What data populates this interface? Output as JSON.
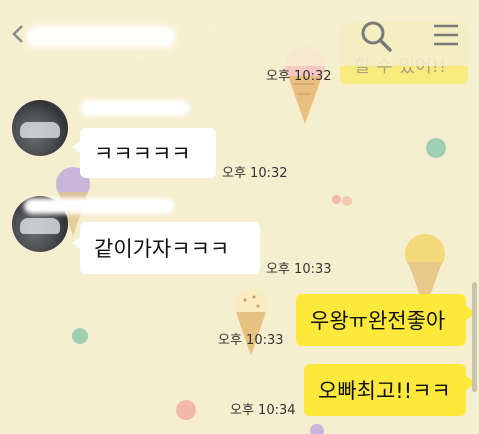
{
  "header": {
    "back_icon": "chevron-left-icon",
    "search_icon": "search-icon",
    "menu_icon": "hamburger-menu-icon"
  },
  "top_message": {
    "text": "할 수 있어!!",
    "time": "오후 10:32"
  },
  "messages": [
    {
      "text": "ㅋㅋㅋㅋㅋ",
      "time": "오후 10:32"
    },
    {
      "text": "같이가자ㅋㅋㅋ",
      "time": "오후 10:33"
    },
    {
      "text": "우왕ㅠ완전좋아",
      "time": "오후 10:33"
    },
    {
      "text": "오빠최고!!ㅋㅋ",
      "time": "오후 10:34"
    }
  ],
  "colors": {
    "background": "#f6efcf",
    "outgoing_bubble": "#fde93b",
    "incoming_bubble": "#ffffff"
  }
}
